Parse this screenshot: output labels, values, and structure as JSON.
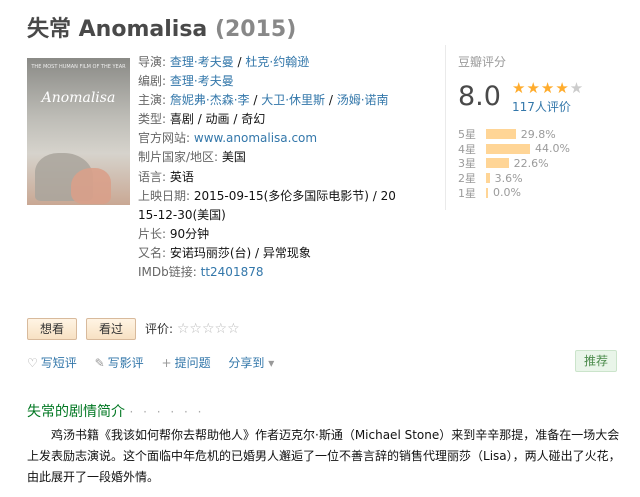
{
  "title": {
    "name": "失常 Anomalisa",
    "year": "(2015)"
  },
  "poster": {
    "tagline": "THE MOST HUMAN FILM OF THE YEAR",
    "name": "Anomalisa"
  },
  "info": {
    "director_label": "导演:",
    "director_1": "查理·考夫曼",
    "director_sep": " / ",
    "director_2": "杜克·约翰逊",
    "writer_label": "编剧:",
    "writer": "查理·考夫曼",
    "cast_label": "主演:",
    "cast_1": "詹妮弗·杰森·李",
    "cast_2": "大卫·休里斯",
    "cast_3": "汤姆·诺南",
    "genre_label": "类型:",
    "genre": "喜剧 / 动画 / 奇幻",
    "site_label": "官方网站:",
    "site": "www.anomalisa.com",
    "country_label": "制片国家/地区:",
    "country": "美国",
    "lang_label": "语言:",
    "lang": "英语",
    "release_label": "上映日期:",
    "release_1": "2015-09-15(多伦多国际电影节) / 20",
    "release_2": "15-12-30(美国)",
    "runtime_label": "片长:",
    "runtime": "90分钟",
    "aka_label": "又名:",
    "aka": "安诺玛丽莎(台) / 异常现象",
    "imdb_label": "IMDb链接:",
    "imdb": "tt2401878"
  },
  "rating": {
    "title": "豆瓣评分",
    "score": "8.0",
    "stars_on": "★★★★",
    "stars_off": "★",
    "votes": "117人评价",
    "dist": [
      {
        "label": "5星",
        "pct": "29.8%",
        "value": 29.8
      },
      {
        "label": "4星",
        "pct": "44.0%",
        "value": 44.0
      },
      {
        "label": "3星",
        "pct": "22.6%",
        "value": 22.6
      },
      {
        "label": "2星",
        "pct": "3.6%",
        "value": 3.6
      },
      {
        "label": "1星",
        "pct": "0.0%",
        "value": 0.0
      }
    ]
  },
  "actions": {
    "want": "想看",
    "seen": "看过",
    "rate_label": "评价:",
    "rate_stars": "☆☆☆☆☆",
    "short_review": "写短评",
    "review": "写影评",
    "question": "提问题",
    "share": "分享到",
    "recommend": "推荐"
  },
  "summary": {
    "title": "失常的剧情简介",
    "dots": "· · · · · ·",
    "text": "鸡汤书籍《我该如何帮你去帮助他人》作者迈克尔·斯通（Michael Stone）来到辛辛那提，准备在一场大会上发表励志演说。这个面临中年危机的已婚男人邂逅了一位不善言辞的销售代理丽莎（Lisa），两人碰出了火花，由此展开了一段婚外情。"
  },
  "colors": {
    "link": "#3377aa",
    "star": "#ffac2d",
    "bar": "#ffd596",
    "section": "#007722"
  }
}
